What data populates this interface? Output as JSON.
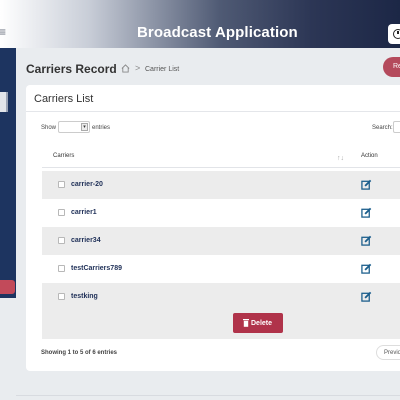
{
  "topbar": {
    "menu_icon_glyph": "≡",
    "app_title": "Broadcast Application",
    "clock_icon": "clock-icon"
  },
  "breadcrumb": {
    "page_title": "Carriers Record",
    "separator": ">",
    "current": "Carrier List",
    "home_icon": "home-icon"
  },
  "top_action": {
    "label": "Re"
  },
  "card": {
    "title": "Carriers List",
    "show_label": "Show",
    "entries_value": "",
    "entries_label": "entries",
    "search_label": "Search:",
    "search_value": ""
  },
  "table": {
    "headers": {
      "carriers": "Carriers",
      "sort_glyph": "↑↓",
      "action": "Action"
    },
    "rows": [
      {
        "name": "carrier-20"
      },
      {
        "name": "carrier1"
      },
      {
        "name": "carrier34"
      },
      {
        "name": "testCarriers789"
      },
      {
        "name": "testking"
      }
    ],
    "edit_icon": "edit-icon"
  },
  "delete_button": {
    "label": "Delete",
    "icon": "trash-icon"
  },
  "footer": {
    "info": "Showing 1 to 5 of 6 entries",
    "prev_label": "Previo"
  },
  "colors": {
    "sidebar": "#1d3460",
    "delete": "#b0334a",
    "accent_pill": "#b44a5c",
    "row_stripe": "#ececec",
    "link": "#1e2f57"
  }
}
